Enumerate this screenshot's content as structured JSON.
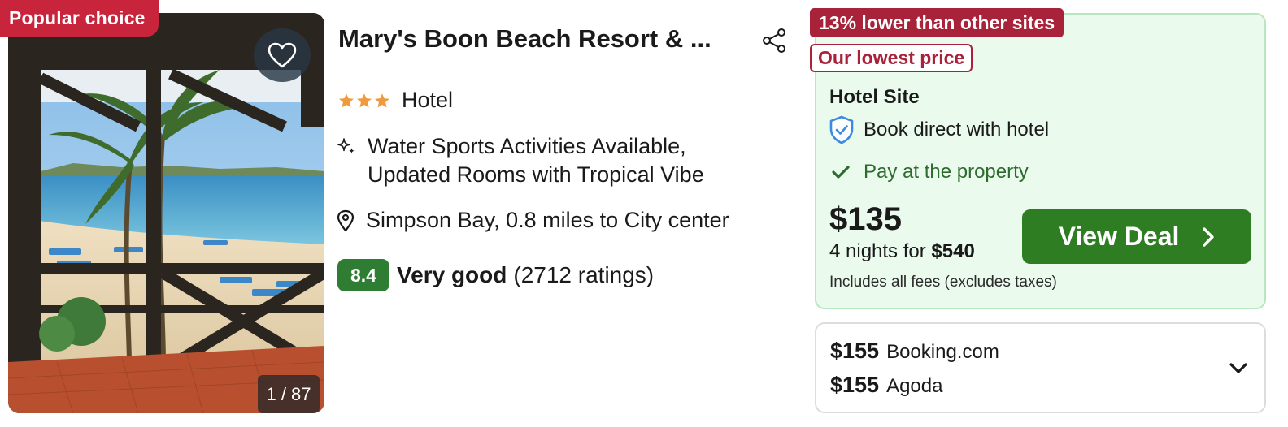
{
  "hotel": {
    "badge": "Popular choice",
    "name": "Mary's Boon Beach Resort & ...",
    "type": "Hotel",
    "star_count": 3,
    "amenities": [
      "Water Sports Activities Available,",
      "Updated Rooms with Tropical Vibe"
    ],
    "location": "Simpson Bay, 0.8 miles to City center",
    "rating": {
      "score": "8.4",
      "label": "Very good",
      "count": "(2712 ratings)"
    },
    "photo_counter": "1 / 87"
  },
  "deal": {
    "savings_tag": "13% lower than other sites",
    "lowest_tag": "Our lowest price",
    "site": "Hotel Site",
    "direct_note": "Book direct with hotel",
    "pay_note": "Pay at the property",
    "price": "$135",
    "nights_text": "4 nights for",
    "nights_total": "$540",
    "fees_note": "Includes all fees (excludes taxes)",
    "cta_label": "View Deal"
  },
  "other_offers": [
    {
      "price": "$155",
      "site": "Booking.com"
    },
    {
      "price": "$155",
      "site": "Agoda"
    }
  ],
  "icons": {
    "favorite": "heart-icon",
    "share": "share-icon",
    "star": "star-icon",
    "amenity": "sparkle-icon",
    "location": "map-pin-icon",
    "verified": "shield-check-icon",
    "check": "check-icon",
    "cta_arrow": "chevron-right-icon",
    "expand": "chevron-down-icon"
  },
  "colors": {
    "popular_badge": "#c8243c",
    "savings_tag": "#a8233a",
    "rating_badge": "#2e7d32",
    "cta": "#2e7d22",
    "deal_bg": "#eafaec",
    "deal_border": "#b7e6c1",
    "star": "#f09a3e"
  }
}
